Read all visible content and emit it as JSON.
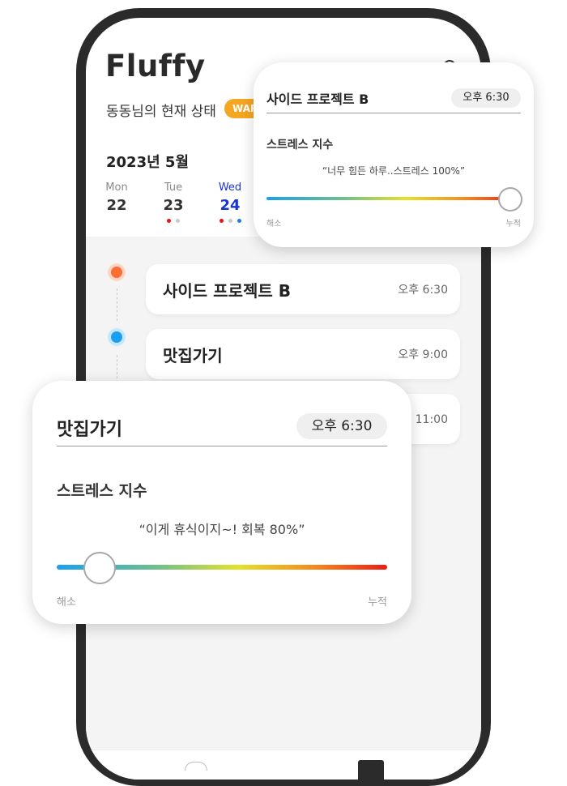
{
  "app": {
    "logo": "Fluffy"
  },
  "header": {
    "status_title": "동동님의 현재 상태",
    "badge": "WARN"
  },
  "calendar": {
    "month": "2023년 5월",
    "days": [
      {
        "name": "Mon",
        "num": "22"
      },
      {
        "name": "Tue",
        "num": "23"
      },
      {
        "name": "Wed",
        "num": "24"
      }
    ]
  },
  "schedule": [
    {
      "title": "사이드 프로젝트 B",
      "time": "오후 6:30"
    },
    {
      "title": "맛집가기",
      "time": "오후 9:00"
    },
    {
      "title": "",
      "time": "후 11:00"
    }
  ],
  "popup_top": {
    "title": "사이드 프로젝트 B",
    "time": "오후 6:30",
    "label": "스트레스 지수",
    "quote": "“너무 힘든 하루..스트레스 100%”",
    "level_percent": 100,
    "min_label": "해소",
    "max_label": "누적"
  },
  "popup_bottom": {
    "title": "맛집가기",
    "time": "오후 6:30",
    "label": "스트레스 지수",
    "quote": "“이게 휴식이지~! 회복 80%”",
    "level_percent": 13,
    "min_label": "해소",
    "max_label": "누적"
  },
  "colors": {
    "accent_blue": "#1a33d9",
    "warn": "#f5a623",
    "marker_orange": "#ff6b35",
    "marker_blue": "#1aa0f0",
    "dot_red": "#e11",
    "dot_gray": "#c8c8c8"
  }
}
